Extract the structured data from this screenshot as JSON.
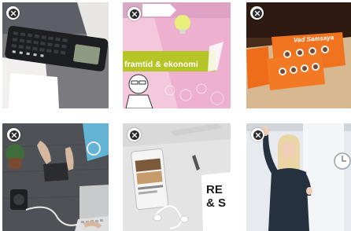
{
  "gallery": {
    "items": [
      {
        "subject": "calculator-on-desk-photo",
        "remove_icon": "close-icon"
      },
      {
        "subject": "economy-booklet-cover-photo",
        "overlay_text": "framtid & ekonomi",
        "remove_icon": "close-icon"
      },
      {
        "subject": "orange-flyers-on-table-photo",
        "overlay_text": "Vad Samsaya",
        "remove_icon": "close-icon"
      },
      {
        "subject": "desk-with-laptop-photo",
        "remove_icon": "close-icon"
      },
      {
        "subject": "phone-and-headphones-photo",
        "overlay_text": "RE\n& S",
        "remove_icon": "close-icon"
      },
      {
        "subject": "woman-waving-presentation-photo",
        "remove_icon": "close-icon"
      }
    ]
  }
}
